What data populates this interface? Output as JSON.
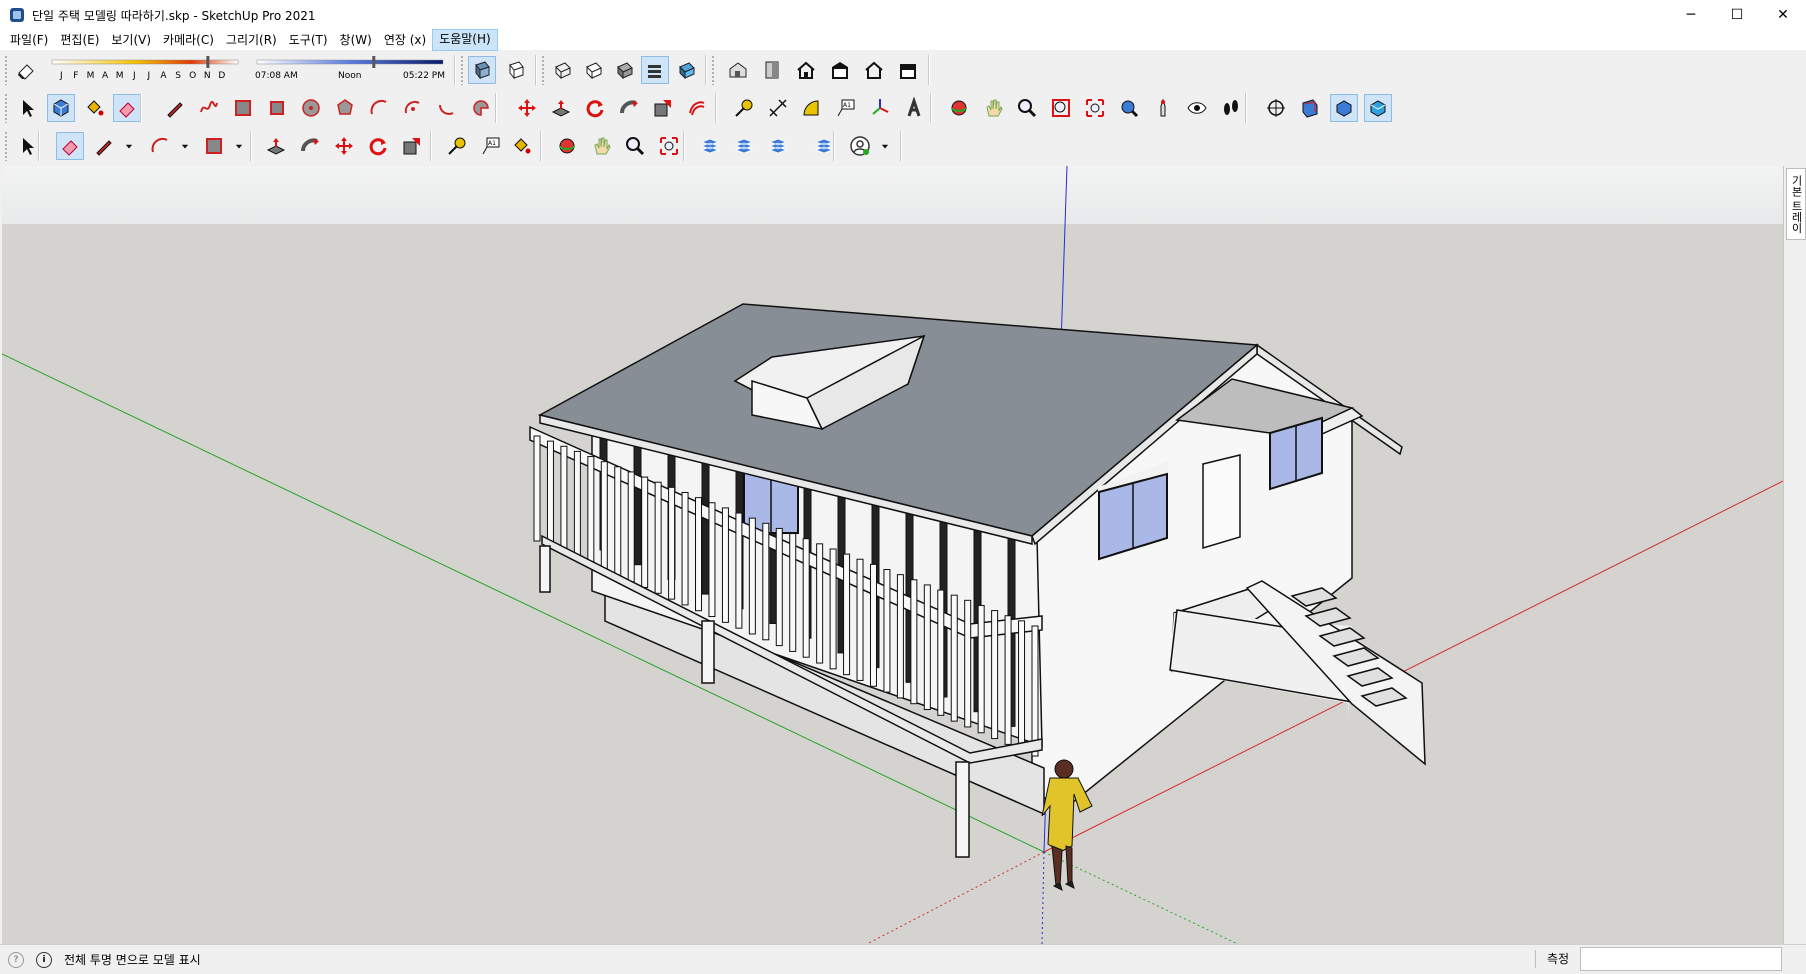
{
  "window": {
    "title": "단일 주택 모델링 따라하기.skp - SketchUp Pro 2021",
    "controls": {
      "minimize": "─",
      "maximize": "☐",
      "close": "✕"
    }
  },
  "menu": {
    "items": [
      {
        "label": "파일(F)"
      },
      {
        "label": "편집(E)"
      },
      {
        "label": "보기(V)"
      },
      {
        "label": "카메라(C)"
      },
      {
        "label": "그리기(R)"
      },
      {
        "label": "도구(T)"
      },
      {
        "label": "창(W)"
      },
      {
        "label": "연장 (x)"
      },
      {
        "label": "도움말(H)",
        "active": true
      }
    ]
  },
  "shadow_settings": {
    "months": [
      "J",
      "F",
      "M",
      "A",
      "M",
      "J",
      "J",
      "A",
      "S",
      "O",
      "N",
      "D"
    ],
    "date_slider": 0.83,
    "time_start": "07:08 AM",
    "time_noon": "Noon",
    "time_end": "05:22 PM",
    "time_slider": 0.62
  },
  "toolbars": {
    "row1_icons": [
      "eraser-icon",
      "face-style-icon",
      "xray-style-icon",
      "components-icon",
      "components-icon",
      "components-icon",
      "components-icon",
      "components-icon",
      "warehouse-icon",
      "warehouse-icon",
      "home-icon",
      "warehouse-icon",
      "home-icon",
      "warehouse-icon"
    ],
    "row2_icons": [
      "select-icon",
      "make-component-icon",
      "paint-bucket-icon",
      "eraser-icon",
      "pencil-icon",
      "freehand-icon",
      "rectangle-icon",
      "rotated-rectangle-icon",
      "circle-icon",
      "polygon-icon",
      "arc-icon",
      "arc2-icon",
      "arc3-icon",
      "pie-icon",
      "move-icon",
      "push-pull-icon",
      "rotate-icon",
      "follow-me-icon",
      "scale-icon",
      "offset-icon",
      "tape-measure-icon",
      "dimension-icon",
      "protractor-icon",
      "text-icon",
      "axes-icon",
      "3d-text-icon",
      "orbit-icon",
      "pan-icon",
      "zoom-icon",
      "zoom-window-icon",
      "zoom-extents-icon",
      "previous-view-icon",
      "position-camera-icon",
      "look-around-icon",
      "walk-icon",
      "section-plane-icon",
      "display-section-planes-icon",
      "display-section-cuts-icon",
      "display-section-fill-icon"
    ],
    "row3_icons": [
      "select-icon",
      "eraser-icon",
      "pencil-icon",
      "dropdown-icon",
      "arc-icon",
      "dropdown-icon",
      "rectangle-icon",
      "dropdown-icon",
      "push-pull-icon",
      "follow-me-icon",
      "move-icon",
      "rotate-icon",
      "scale-icon",
      "tape-measure-icon",
      "text-icon",
      "paint-bucket-icon",
      "orbit-icon",
      "pan-icon",
      "zoom-icon",
      "zoom-extents-icon",
      "sandbox-icon",
      "sandbox-icon",
      "sandbox-icon",
      "sandbox-icon",
      "account-icon",
      "dropdown-icon"
    ]
  },
  "tray": {
    "label": "기본 트레이"
  },
  "status": {
    "message": "전체 투명 면으로 모델 표시",
    "measure_label": "측정",
    "measure_value": ""
  },
  "model": {
    "colors": {
      "background": "#d4d3cf",
      "sky": "#eeeff0",
      "roof": "#878e96",
      "wall": "#f7f7f7",
      "window": "#a9b8e6",
      "axis_red": "#d62b2b",
      "axis_green": "#2aa32a",
      "axis_blue": "#2b2bd6"
    }
  }
}
